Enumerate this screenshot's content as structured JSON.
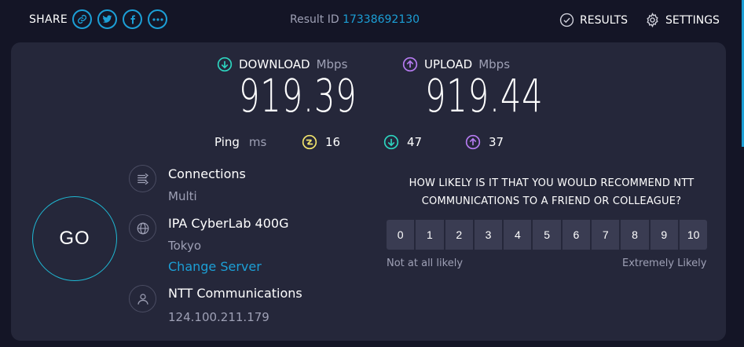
{
  "header": {
    "share_label": "SHARE",
    "share_buttons": [
      {
        "icon": "link-icon"
      },
      {
        "icon": "twitter-icon"
      },
      {
        "icon": "facebook-icon"
      },
      {
        "icon": "more-icon"
      }
    ],
    "result_id_label": "Result ID",
    "result_id_value": "17338692130",
    "results_label": "RESULTS",
    "settings_label": "SETTINGS"
  },
  "speeds": {
    "download": {
      "label": "DOWNLOAD",
      "unit": "Mbps",
      "value": "919.39",
      "color": "#2dd4bf"
    },
    "upload": {
      "label": "UPLOAD",
      "unit": "Mbps",
      "value": "919.44",
      "color": "#b57bf0"
    }
  },
  "ping": {
    "label": "Ping",
    "unit": "ms",
    "idle": "16",
    "download": "47",
    "upload": "37",
    "idle_color": "#f2e46c"
  },
  "go_label": "GO",
  "connections": {
    "title": "Connections",
    "value": "Multi"
  },
  "server": {
    "title": "IPA CyberLab 400G",
    "location": "Tokyo",
    "change_label": "Change Server"
  },
  "isp": {
    "title": "NTT Communications",
    "ip": "124.100.211.179"
  },
  "survey": {
    "question_line1": "HOW LIKELY IS IT THAT YOU WOULD RECOMMEND NTT",
    "question_line2": "COMMUNICATIONS TO A FRIEND OR COLLEAGUE?",
    "scale": [
      "0",
      "1",
      "2",
      "3",
      "4",
      "5",
      "6",
      "7",
      "8",
      "9",
      "10"
    ],
    "low_label": "Not at all likely",
    "high_label": "Extremely Likely"
  },
  "colors": {
    "accent": "#1c9fd6",
    "background": "#141526",
    "panel": "#25273a"
  }
}
